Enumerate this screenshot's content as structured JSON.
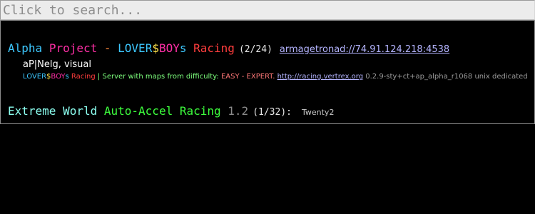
{
  "search": {
    "placeholder": "Click to search..."
  },
  "servers": [
    {
      "name_parts": [
        {
          "text": "Alpha",
          "color": "#3dc8ff"
        },
        {
          "text": " ",
          "color": "#ffffff"
        },
        {
          "text": "Project",
          "color": "#ff2fa6"
        },
        {
          "text": " - ",
          "color": "#ff8a3d"
        },
        {
          "text": "LOVER",
          "color": "#3dc8ff"
        },
        {
          "text": "$",
          "color": "#ffe24a"
        },
        {
          "text": "BOY",
          "color": "#ff2fa6"
        },
        {
          "text": "s ",
          "color": "#3dc8ff"
        },
        {
          "text": "Racing",
          "color": "#ff3d3d"
        }
      ],
      "player_count": "(2/24)",
      "address": "armagetronad://74.91.124.218:4538",
      "players": "aP|Nelg, visual",
      "description_parts": [
        {
          "text": "LOVER",
          "color": "#3dc8ff"
        },
        {
          "text": "$",
          "color": "#ffe24a"
        },
        {
          "text": "BOY",
          "color": "#ff2fa6"
        },
        {
          "text": "s ",
          "color": "#3dc8ff"
        },
        {
          "text": "Racing",
          "color": "#ff3d3d"
        },
        {
          "text": " | Server with maps from difficulty: ",
          "color": "#7dff7d"
        },
        {
          "text": "EASY - EXPERT.",
          "color": "#ff7878"
        },
        {
          "text": " ",
          "color": "#ffffff"
        }
      ],
      "description_link": "http://racing.vertrex.org",
      "version": " 0.2.9-sty+ct+ap_alpha_r1068 unix dedicated",
      "version_color": "#9a9a9a"
    },
    {
      "name_parts": [
        {
          "text": "Extreme World",
          "color": "#8cfff0"
        },
        {
          "text": " ",
          "color": "#ffffff"
        },
        {
          "text": "Auto-Accel Racing",
          "color": "#3dff3d"
        },
        {
          "text": " ",
          "color": "#ffffff"
        },
        {
          "text": "1.2",
          "color": "#8c8c8c"
        }
      ],
      "player_count": "(1/32):",
      "players": "Twenty2"
    }
  ]
}
